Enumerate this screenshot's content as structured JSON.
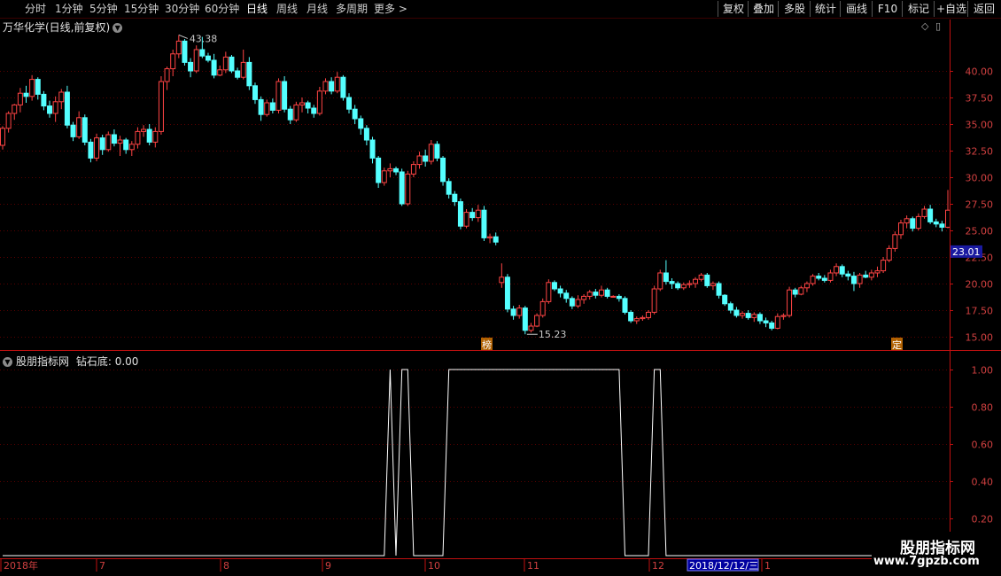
{
  "toolbar": {
    "periods": [
      "分时",
      "1分钟",
      "5分钟",
      "15分钟",
      "30分钟",
      "60分钟",
      "日线",
      "周线",
      "月线",
      "多周期",
      "更多 >"
    ],
    "active_period": "日线",
    "right_buttons": [
      "复权",
      "叠加",
      "多股",
      "统计",
      "画线",
      "F10",
      "标记",
      "+自选",
      "返回"
    ]
  },
  "stock": {
    "title": "万华化学(日线,前复权)",
    "high_label": "43.38",
    "low_label": "15.23",
    "current_price": "23.01",
    "marker_left": "榜",
    "marker_right": "定"
  },
  "indicator": {
    "title": "股朋指标网",
    "name": "钻石底",
    "value": "0.00",
    "levels": [
      "1.00",
      "0.80",
      "0.60",
      "0.40",
      "0.20"
    ]
  },
  "price_axis": [
    "40.00",
    "37.50",
    "35.00",
    "32.50",
    "30.00",
    "27.50",
    "25.00",
    "22.50",
    "20.00",
    "17.50",
    "15.00"
  ],
  "time_axis": {
    "labels": [
      "2018年",
      "7",
      "8",
      "9",
      "10",
      "11",
      "12",
      "1"
    ],
    "cursor_date": "2018/12/12/三"
  },
  "watermark": {
    "line1": "股朋指标网",
    "line2": "www.7gpzb.com"
  },
  "colors": {
    "up": "#ff4444",
    "down": "#54ffff",
    "grid": "#5a0000",
    "axis": "#c01010"
  },
  "chart_data": {
    "type": "candlestick",
    "candles_ohlc": [
      [
        33.0,
        34.8,
        32.6,
        34.6
      ],
      [
        34.6,
        36.2,
        34.2,
        36.0
      ],
      [
        36.0,
        36.9,
        35.4,
        36.8
      ],
      [
        36.8,
        38.4,
        36.1,
        37.9
      ],
      [
        37.9,
        38.6,
        37.0,
        37.6
      ],
      [
        37.6,
        39.6,
        37.2,
        39.2
      ],
      [
        39.2,
        39.4,
        37.3,
        37.8
      ],
      [
        37.8,
        38.1,
        36.3,
        36.7
      ],
      [
        36.7,
        37.2,
        35.6,
        36.0
      ],
      [
        36.0,
        37.6,
        35.2,
        37.1
      ],
      [
        37.1,
        38.3,
        36.4,
        38.0
      ],
      [
        38.0,
        38.6,
        34.6,
        34.9
      ],
      [
        34.9,
        35.2,
        33.4,
        33.8
      ],
      [
        33.8,
        36.2,
        33.6,
        35.6
      ],
      [
        35.6,
        35.9,
        33.0,
        33.3
      ],
      [
        33.3,
        33.6,
        31.4,
        31.8
      ],
      [
        31.8,
        34.1,
        31.5,
        33.7
      ],
      [
        33.7,
        34.0,
        32.1,
        32.6
      ],
      [
        32.6,
        34.3,
        32.4,
        34.0
      ],
      [
        34.0,
        34.5,
        32.9,
        33.2
      ],
      [
        33.2,
        33.9,
        32.0,
        33.5
      ],
      [
        33.5,
        33.7,
        32.2,
        32.6
      ],
      [
        32.6,
        33.4,
        32.0,
        33.1
      ],
      [
        33.1,
        34.7,
        32.7,
        34.3
      ],
      [
        34.3,
        34.9,
        33.8,
        34.5
      ],
      [
        34.5,
        35.0,
        33.0,
        33.3
      ],
      [
        33.3,
        34.7,
        32.8,
        34.3
      ],
      [
        34.3,
        39.5,
        34.0,
        39.0
      ],
      [
        39.0,
        40.4,
        38.2,
        40.2
      ],
      [
        40.2,
        42.0,
        39.5,
        41.6
      ],
      [
        41.6,
        43.38,
        41.2,
        42.8
      ],
      [
        42.8,
        43.0,
        40.5,
        40.8
      ],
      [
        40.8,
        41.2,
        39.4,
        40.0
      ],
      [
        40.0,
        42.4,
        39.8,
        42.0
      ],
      [
        42.0,
        43.2,
        41.2,
        41.4
      ],
      [
        41.4,
        41.7,
        40.8,
        41.0
      ],
      [
        41.0,
        41.6,
        39.3,
        39.6
      ],
      [
        39.6,
        40.5,
        39.5,
        40.1
      ],
      [
        40.1,
        41.8,
        39.8,
        41.3
      ],
      [
        41.3,
        41.5,
        39.8,
        40.0
      ],
      [
        40.0,
        40.3,
        39.2,
        39.4
      ],
      [
        39.4,
        42.0,
        39.2,
        40.8
      ],
      [
        40.8,
        41.3,
        38.2,
        38.6
      ],
      [
        38.6,
        38.9,
        36.9,
        37.3
      ],
      [
        37.3,
        37.6,
        35.3,
        35.9
      ],
      [
        35.9,
        37.3,
        35.7,
        37.0
      ],
      [
        37.0,
        37.4,
        36.0,
        36.3
      ],
      [
        36.3,
        39.3,
        36.0,
        39.0
      ],
      [
        39.0,
        39.5,
        36.1,
        36.4
      ],
      [
        36.4,
        36.7,
        35.0,
        35.4
      ],
      [
        35.4,
        37.1,
        35.2,
        36.8
      ],
      [
        36.8,
        37.5,
        36.1,
        37.0
      ],
      [
        37.0,
        37.2,
        36.0,
        36.5
      ],
      [
        36.5,
        36.8,
        35.6,
        36.0
      ],
      [
        36.0,
        38.5,
        35.8,
        38.1
      ],
      [
        38.1,
        39.3,
        37.8,
        39.0
      ],
      [
        39.0,
        39.4,
        37.8,
        38.1
      ],
      [
        38.1,
        39.9,
        37.9,
        39.4
      ],
      [
        39.4,
        39.6,
        37.2,
        37.5
      ],
      [
        37.5,
        37.9,
        36.0,
        36.4
      ],
      [
        36.4,
        36.8,
        35.0,
        35.5
      ],
      [
        35.5,
        35.8,
        34.0,
        34.6
      ],
      [
        34.6,
        34.9,
        33.0,
        33.5
      ],
      [
        33.5,
        33.8,
        31.3,
        31.8
      ],
      [
        31.8,
        32.0,
        29.0,
        29.5
      ],
      [
        29.5,
        30.9,
        29.2,
        30.6
      ],
      [
        30.6,
        31.3,
        30.0,
        30.8
      ],
      [
        30.8,
        31.0,
        30.2,
        30.5
      ],
      [
        30.5,
        30.8,
        27.3,
        27.5
      ],
      [
        27.5,
        30.6,
        27.3,
        30.3
      ],
      [
        30.3,
        31.5,
        30.0,
        31.2
      ],
      [
        31.2,
        32.4,
        30.8,
        32.0
      ],
      [
        32.0,
        32.6,
        31.0,
        31.5
      ],
      [
        31.5,
        33.5,
        31.2,
        33.1
      ],
      [
        33.1,
        33.4,
        31.5,
        31.8
      ],
      [
        31.8,
        32.0,
        29.2,
        29.6
      ],
      [
        29.6,
        29.9,
        28.0,
        28.4
      ],
      [
        28.4,
        28.7,
        27.3,
        27.7
      ],
      [
        27.7,
        28.0,
        25.1,
        25.4
      ],
      [
        25.4,
        27.0,
        25.2,
        26.7
      ],
      [
        26.7,
        27.1,
        25.9,
        26.2
      ],
      [
        26.2,
        27.4,
        25.8,
        26.9
      ],
      [
        26.9,
        27.3,
        24.0,
        24.3
      ],
      [
        24.3,
        24.7,
        23.8,
        24.4
      ],
      [
        24.4,
        24.8,
        23.6,
        23.9
      ],
      [
        20.1,
        21.9,
        19.6,
        20.6
      ],
      [
        20.6,
        20.9,
        17.3,
        17.6
      ],
      [
        17.6,
        17.9,
        16.6,
        17.0
      ],
      [
        17.0,
        18.0,
        16.7,
        17.7
      ],
      [
        17.7,
        17.9,
        15.23,
        15.6
      ],
      [
        15.6,
        16.3,
        15.4,
        16.0
      ],
      [
        16.0,
        17.2,
        15.9,
        17.0
      ],
      [
        17.0,
        18.6,
        16.8,
        18.3
      ],
      [
        18.3,
        20.4,
        18.1,
        20.1
      ],
      [
        20.1,
        20.3,
        19.3,
        19.5
      ],
      [
        19.5,
        19.8,
        18.7,
        19.1
      ],
      [
        19.1,
        19.4,
        18.2,
        18.6
      ],
      [
        18.6,
        18.8,
        17.6,
        17.9
      ],
      [
        17.9,
        18.9,
        17.7,
        18.5
      ],
      [
        18.5,
        19.0,
        18.1,
        18.8
      ],
      [
        18.8,
        19.4,
        18.5,
        19.2
      ],
      [
        19.2,
        19.5,
        18.6,
        18.9
      ],
      [
        18.9,
        19.8,
        18.7,
        19.4
      ],
      [
        19.4,
        19.6,
        18.6,
        18.8
      ],
      [
        18.8,
        18.9,
        18.7,
        18.8
      ],
      [
        18.8,
        19.0,
        18.3,
        18.6
      ],
      [
        18.6,
        18.8,
        17.1,
        17.3
      ],
      [
        17.3,
        17.5,
        16.3,
        16.5
      ],
      [
        16.5,
        16.9,
        16.2,
        16.7
      ],
      [
        16.7,
        17.0,
        16.5,
        16.8
      ],
      [
        16.8,
        17.5,
        16.6,
        17.3
      ],
      [
        17.3,
        19.8,
        17.1,
        19.5
      ],
      [
        19.5,
        21.3,
        19.3,
        21.0
      ],
      [
        21.0,
        22.2,
        19.9,
        20.2
      ],
      [
        20.2,
        20.5,
        19.5,
        20.0
      ],
      [
        20.0,
        20.2,
        19.4,
        19.6
      ],
      [
        19.6,
        20.1,
        19.4,
        19.9
      ],
      [
        19.9,
        20.3,
        19.6,
        20.0
      ],
      [
        20.0,
        20.6,
        19.6,
        20.4
      ],
      [
        20.4,
        21.0,
        20.2,
        20.8
      ],
      [
        20.8,
        21.0,
        19.6,
        19.8
      ],
      [
        19.8,
        20.2,
        19.4,
        20.0
      ],
      [
        20.0,
        20.2,
        18.6,
        18.9
      ],
      [
        18.9,
        19.0,
        17.9,
        18.1
      ],
      [
        18.1,
        18.3,
        17.2,
        17.5
      ],
      [
        17.5,
        17.8,
        16.8,
        17.0
      ],
      [
        17.0,
        17.4,
        16.7,
        17.2
      ],
      [
        17.2,
        17.5,
        16.6,
        16.8
      ],
      [
        16.8,
        17.3,
        16.4,
        17.1
      ],
      [
        17.1,
        17.3,
        16.2,
        16.5
      ],
      [
        16.5,
        16.8,
        15.9,
        16.3
      ],
      [
        16.3,
        16.5,
        15.6,
        15.8
      ],
      [
        15.8,
        17.2,
        15.7,
        16.9
      ],
      [
        16.9,
        17.2,
        16.6,
        17.0
      ],
      [
        17.0,
        19.7,
        16.8,
        19.4
      ],
      [
        19.4,
        19.6,
        18.7,
        19.0
      ],
      [
        19.0,
        19.8,
        18.9,
        19.6
      ],
      [
        19.6,
        20.2,
        19.2,
        20.0
      ],
      [
        20.0,
        20.9,
        19.8,
        20.7
      ],
      [
        20.7,
        21.0,
        20.3,
        20.5
      ],
      [
        20.5,
        20.8,
        20.1,
        20.3
      ],
      [
        20.3,
        21.3,
        20.1,
        21.0
      ],
      [
        21.0,
        21.9,
        20.7,
        21.6
      ],
      [
        21.6,
        21.8,
        20.6,
        20.9
      ],
      [
        20.9,
        21.2,
        20.3,
        20.7
      ],
      [
        20.7,
        21.1,
        19.3,
        20.0
      ],
      [
        20.0,
        21.0,
        19.6,
        20.8
      ],
      [
        20.8,
        21.2,
        20.5,
        20.6
      ],
      [
        20.6,
        21.3,
        20.3,
        21.0
      ],
      [
        21.0,
        21.6,
        20.6,
        21.2
      ],
      [
        21.2,
        22.5,
        21.0,
        22.2
      ],
      [
        22.2,
        23.6,
        22.0,
        23.3
      ],
      [
        23.3,
        24.9,
        23.0,
        24.6
      ],
      [
        24.6,
        26.0,
        24.2,
        25.7
      ],
      [
        25.7,
        26.4,
        25.2,
        26.1
      ],
      [
        26.1,
        26.3,
        24.9,
        25.2
      ],
      [
        25.2,
        26.6,
        25.0,
        26.3
      ],
      [
        26.3,
        27.3,
        26.1,
        27.0
      ],
      [
        27.0,
        27.4,
        25.6,
        25.8
      ],
      [
        25.8,
        26.1,
        25.3,
        25.6
      ],
      [
        25.6,
        25.9,
        24.9,
        25.3
      ],
      [
        25.3,
        28.8,
        25.2,
        26.9
      ]
    ],
    "indicator_series": [
      0,
      0,
      0,
      0,
      0,
      0,
      0,
      0,
      0,
      0,
      0,
      0,
      0,
      0,
      0,
      0,
      0,
      0,
      0,
      0,
      0,
      0,
      0,
      0,
      0,
      0,
      0,
      0,
      0,
      0,
      0,
      0,
      0,
      0,
      0,
      0,
      0,
      0,
      0,
      0,
      0,
      0,
      0,
      0,
      0,
      0,
      0,
      0,
      0,
      0,
      0,
      0,
      0,
      0,
      0,
      0,
      0,
      0,
      0,
      0,
      0,
      0,
      0,
      0,
      0,
      0,
      1,
      0,
      1,
      1,
      0,
      0,
      0,
      0,
      0,
      0,
      1,
      1,
      1,
      1,
      1,
      1,
      1,
      1,
      1,
      1,
      1,
      1,
      1,
      1,
      1,
      1,
      1,
      1,
      1,
      1,
      1,
      1,
      1,
      1,
      1,
      1,
      1,
      1,
      1,
      1,
      0,
      0,
      0,
      0,
      0,
      1,
      1,
      0,
      0,
      0,
      0,
      0,
      0,
      0,
      0,
      0,
      0,
      0,
      0,
      0,
      0,
      0,
      0,
      0,
      0,
      0,
      0,
      0,
      0,
      0,
      0,
      0,
      0,
      0,
      0,
      0,
      0,
      0,
      0,
      0,
      0,
      0,
      0,
      0,
      0,
      0,
      0,
      0,
      0,
      0,
      0,
      0,
      0
    ],
    "y_range_price": [
      14.0,
      44.5
    ],
    "y_range_indicator": [
      0,
      1.05
    ]
  }
}
